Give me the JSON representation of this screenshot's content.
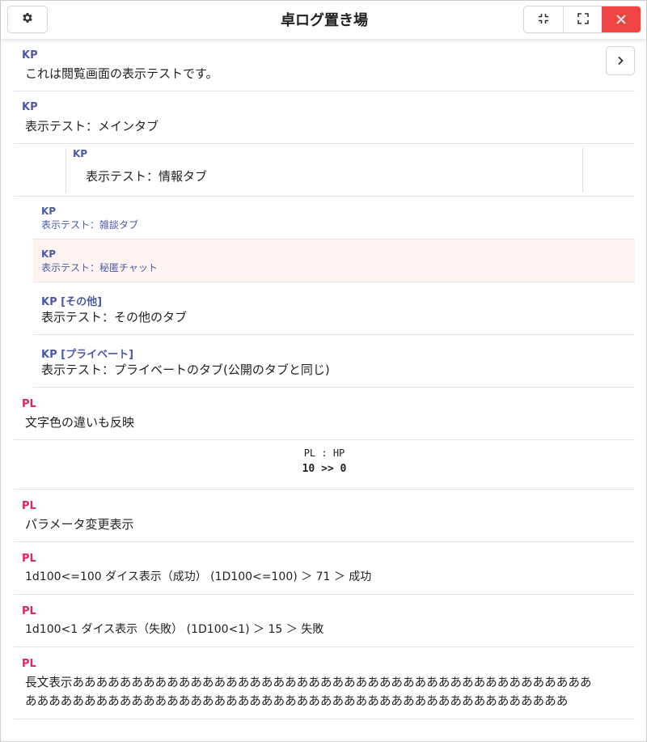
{
  "header": {
    "title": "卓ログ置き場",
    "icons": {
      "settings": "gear-icon",
      "minimize": "compress-icon",
      "fullscreen": "expand-icon",
      "close": "close-icon"
    },
    "close_color": "#ef4444"
  },
  "nav": {
    "icon": "chevron-right-icon"
  },
  "colors": {
    "kp": "#4b5aa8",
    "pl": "#e0245e",
    "secret_bg": "#fff4f2"
  },
  "log": [
    {
      "name": "KP",
      "text": "これは閲覧画面の表示テストです。"
    },
    {
      "name": "KP",
      "text": "表示テスト：メインタブ"
    },
    {
      "name": "KP",
      "text": "表示テスト：情報タブ"
    },
    {
      "name": "KP",
      "text": "表示テスト：雑談タブ"
    },
    {
      "name": "KP",
      "text": "表示テスト：秘匿チャット"
    },
    {
      "name": "KP [その他]",
      "text": "表示テスト：その他のタブ"
    },
    {
      "name": "KP [プライベート]",
      "text": "表示テスト：プライベートのタブ(公開のタブと同じ)"
    },
    {
      "name": "PL",
      "text": "文字色の違いも反映"
    },
    {
      "param": "PL : HP",
      "change": "10 >> 0"
    },
    {
      "name": "PL",
      "text": "パラメータ変更表示"
    },
    {
      "name": "PL",
      "text": "1d100<=100 ダイス表示（成功） (1D100<=100) ＞ 71 ＞ 成功"
    },
    {
      "name": "PL",
      "text": "1d100<1 ダイス表示（失敗） (1D100<1) ＞ 15 ＞ 失敗"
    },
    {
      "name": "PL",
      "lines": [
        "長文表示ああああああああああああああああああああああああああああああああああああああああああああ",
        "ああああああああああああああああああああああああああああああああああああああああああああああ"
      ]
    }
  ]
}
